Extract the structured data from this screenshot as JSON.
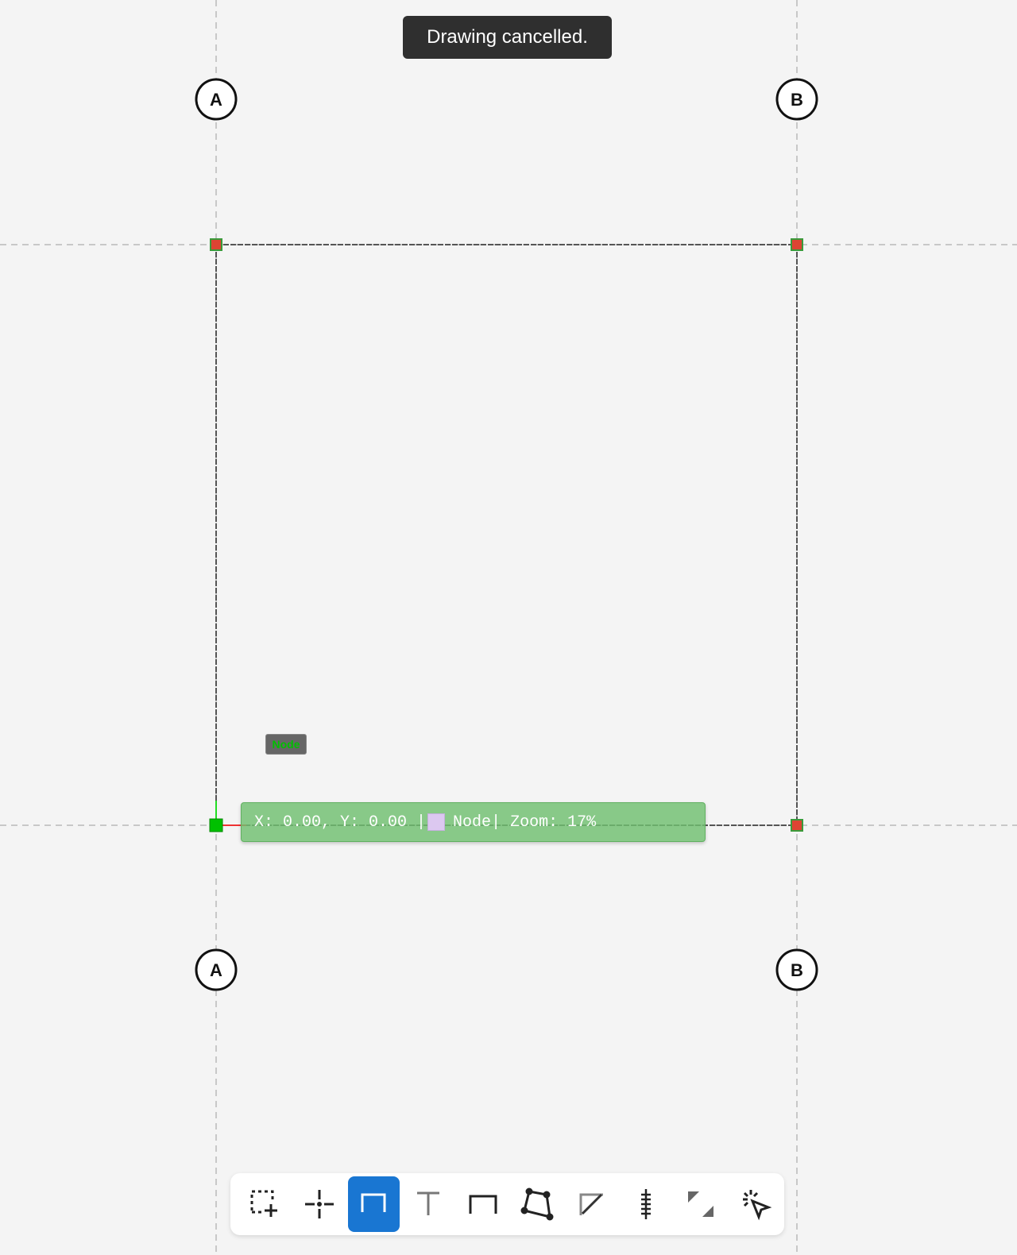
{
  "toast": {
    "message": "Drawing cancelled."
  },
  "grid_labels": {
    "top_left": "A",
    "top_right": "B",
    "bottom_left": "A",
    "bottom_right": "B"
  },
  "node_tag": {
    "label": "Node"
  },
  "status_bar": {
    "coords": "X: 0.00, Y: 0.00 |",
    "mode": "Node",
    "zoom": "| Zoom: 17%",
    "swatch_color": "#dcc8f0"
  },
  "toolbar": {
    "active_tool": "beam-tool",
    "tools": [
      {
        "name": "add-selection-tool",
        "icon": "selection-add-icon"
      },
      {
        "name": "node-tool",
        "icon": "crosshair-icon"
      },
      {
        "name": "beam-tool",
        "icon": "beam-icon"
      },
      {
        "name": "column-tool",
        "icon": "t-column-icon"
      },
      {
        "name": "frame-tool",
        "icon": "frame-icon"
      },
      {
        "name": "polygon-tool",
        "icon": "polygon-icon"
      },
      {
        "name": "brace-tool",
        "icon": "brace-icon"
      },
      {
        "name": "dimension-tool",
        "icon": "dimension-icon"
      },
      {
        "name": "resize-tool",
        "icon": "resize-icon"
      },
      {
        "name": "select-tool",
        "icon": "cursor-click-icon"
      }
    ]
  },
  "colors": {
    "accent": "#1976d2",
    "node_marker": "#dd4433",
    "node_fill": "#3a9a3a",
    "origin_node": "#00c000",
    "status_bg": "#70c070"
  }
}
